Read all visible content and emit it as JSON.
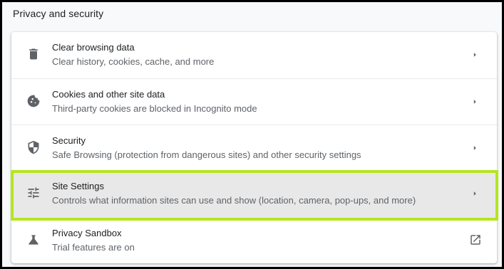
{
  "section": {
    "title": "Privacy and security"
  },
  "rows": [
    {
      "label": "Clear browsing data",
      "sub": "Clear history, cookies, cache, and more",
      "icon": "trash-icon",
      "action": "arrow-right-icon"
    },
    {
      "label": "Cookies and other site data",
      "sub": "Third-party cookies are blocked in Incognito mode",
      "icon": "cookie-icon",
      "action": "arrow-right-icon"
    },
    {
      "label": "Security",
      "sub": "Safe Browsing (protection from dangerous sites) and other security settings",
      "icon": "shield-icon",
      "action": "arrow-right-icon"
    },
    {
      "label": "Site Settings",
      "sub": "Controls what information sites can use and show (location, camera, pop-ups, and more)",
      "icon": "tune-sliders-icon",
      "action": "arrow-right-icon",
      "highlighted": true
    },
    {
      "label": "Privacy Sandbox",
      "sub": "Trial features are on",
      "icon": "flask-icon",
      "action": "open-in-new-icon"
    }
  ],
  "colors": {
    "highlight_border": "#b5e61d",
    "highlight_bg": "#e8e8e8",
    "icon": "#5f6368",
    "primary_text": "#202124",
    "secondary_text": "#5f6368"
  }
}
